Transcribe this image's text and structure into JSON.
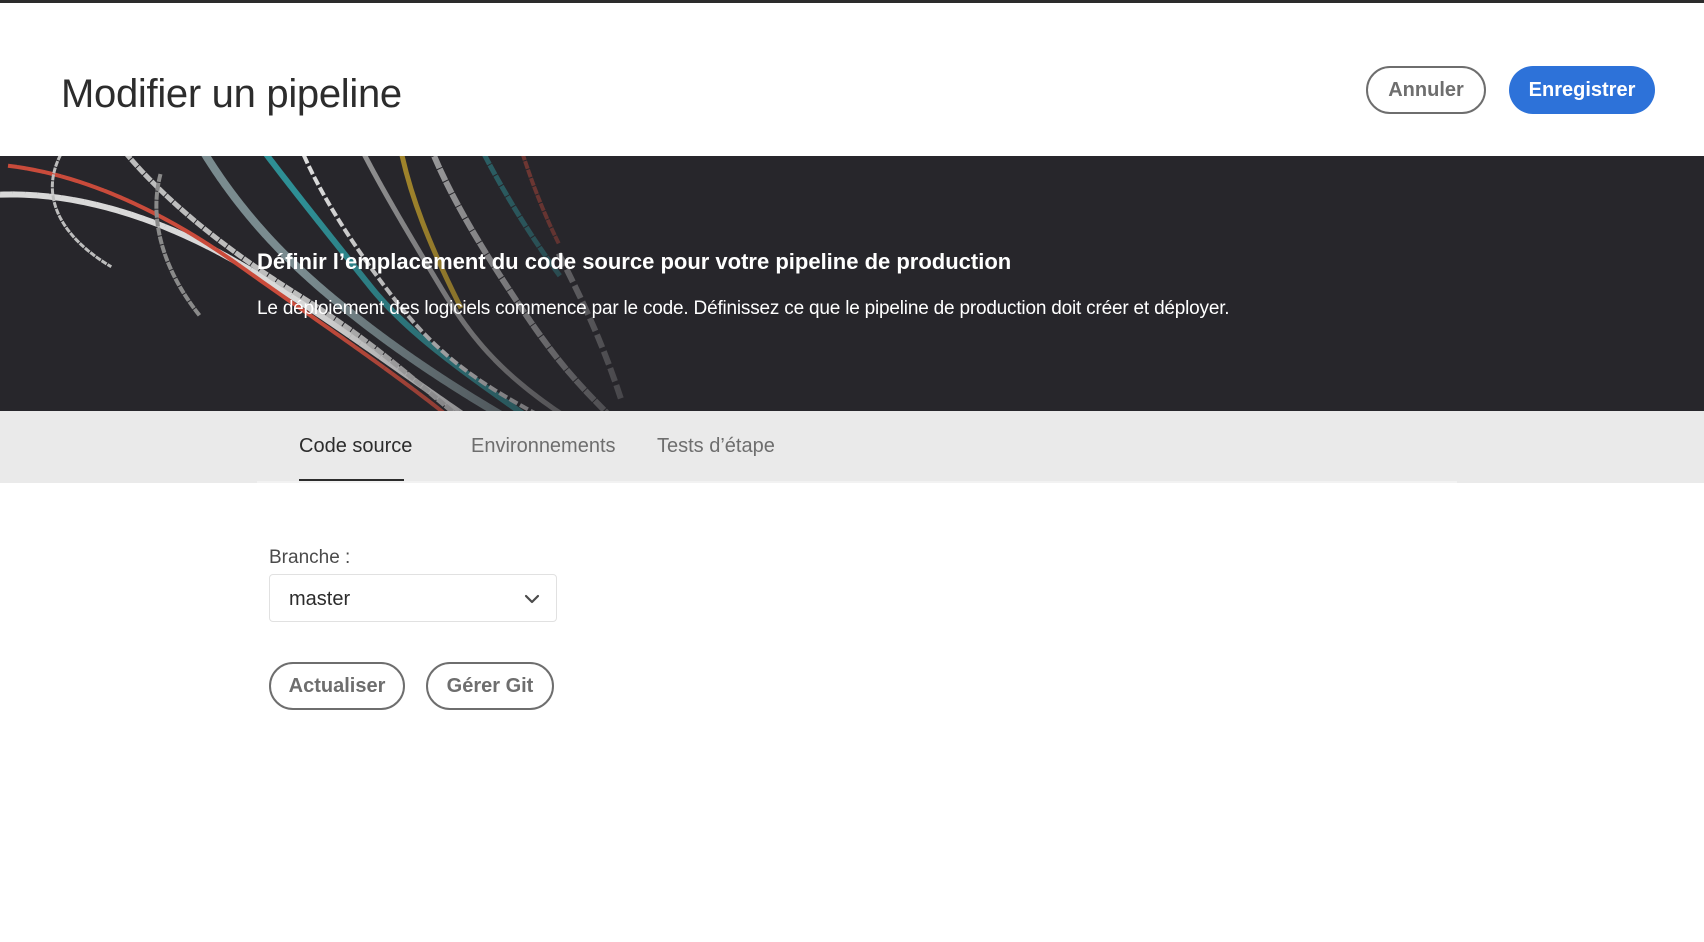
{
  "header": {
    "title": "Modifier un pipeline",
    "cancel_label": "Annuler",
    "save_label": "Enregistrer"
  },
  "hero": {
    "title": "Définir l’emplacement du code source pour votre pipeline de production",
    "description": "Le déploiement des logiciels commence par le code. Définissez ce que le pipeline de production doit créer et déployer."
  },
  "tabs": [
    {
      "label": "Code source",
      "active": true
    },
    {
      "label": "Environnements",
      "active": false
    },
    {
      "label": "Tests d’étape",
      "active": false
    }
  ],
  "branch": {
    "label": "Branche :",
    "value": "master",
    "icon": "chevron-down-icon"
  },
  "actions": {
    "refresh_label": "Actualiser",
    "manage_git_label": "Gérer Git"
  },
  "colors": {
    "accent": "#2d72d9",
    "hero_background": "#27262b",
    "tabbar_background": "#eaeaea",
    "outline_button": "#6e6e6e"
  }
}
